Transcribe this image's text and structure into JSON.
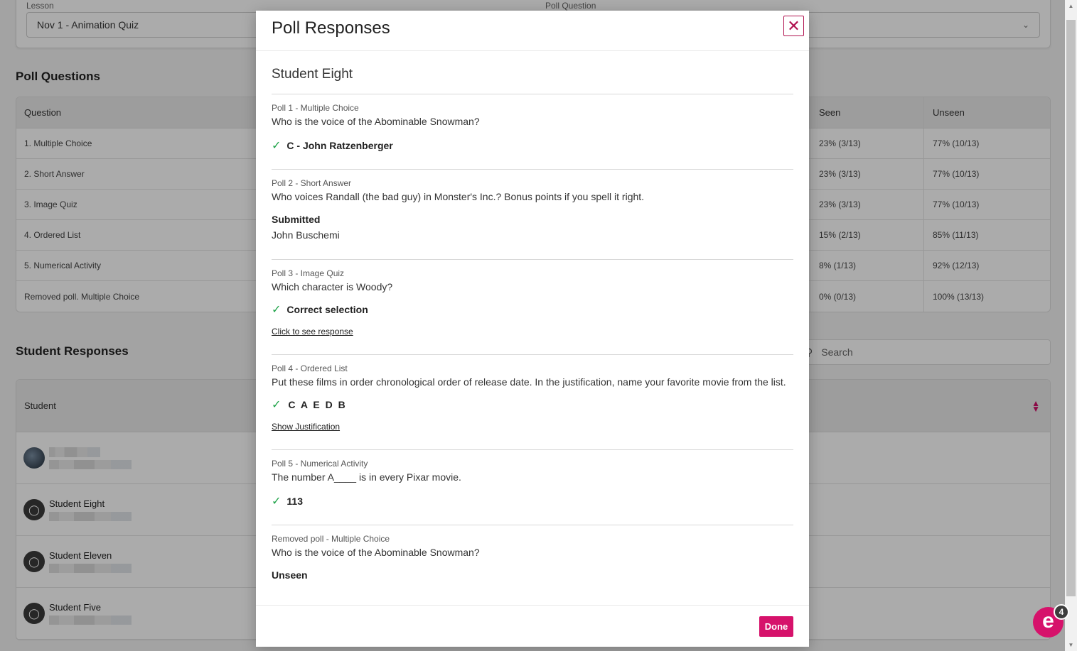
{
  "filters": {
    "lesson_label": "Lesson",
    "lesson_value": "Nov 1 - Animation Quiz",
    "question_label": "Poll Question"
  },
  "poll_questions": {
    "title": "Poll Questions",
    "headers": {
      "question": "Question",
      "seen": "Seen",
      "unseen": "Unseen"
    },
    "rows": [
      {
        "question": "1. Multiple Choice",
        "seen": "23% (3/13)",
        "unseen": "77% (10/13)"
      },
      {
        "question": "2. Short Answer",
        "seen": "23% (3/13)",
        "unseen": "77% (10/13)"
      },
      {
        "question": "3. Image Quiz",
        "seen": "23% (3/13)",
        "unseen": "77% (10/13)"
      },
      {
        "question": "4. Ordered List",
        "seen": "15% (2/13)",
        "unseen": "85% (11/13)"
      },
      {
        "question": "5. Numerical Activity",
        "seen": "8% (1/13)",
        "unseen": "92% (12/13)"
      },
      {
        "question": "Removed poll. Multiple Choice",
        "seen": "0% (0/13)",
        "unseen": "100% (13/13)"
      }
    ]
  },
  "student_responses": {
    "title": "Student Responses",
    "search_placeholder": "Search",
    "header_student": "Student",
    "rows": [
      {
        "name": ""
      },
      {
        "name": "Student Eight"
      },
      {
        "name": "Student Eleven"
      },
      {
        "name": "Student Five"
      }
    ]
  },
  "modal": {
    "title": "Poll Responses",
    "close_symbol": "✕",
    "student_name": "Student Eight",
    "polls": [
      {
        "label": "Poll 1 - Multiple Choice",
        "question": "Who is the voice of the Abominable Snowman?",
        "answer": "C - John Ratzenberger"
      },
      {
        "label": "Poll 2 - Short Answer",
        "question": "Who voices Randall (the bad guy) in Monster's Inc.? Bonus points if you spell it right.",
        "status": "Submitted",
        "answer": "John Buschemi"
      },
      {
        "label": "Poll 3 - Image Quiz",
        "question": "Which character is Woody?",
        "answer": "Correct selection",
        "link": "Click to see response"
      },
      {
        "label": "Poll 4 - Ordered List",
        "question": "Put these films in order chronological order of release date. In the justification, name your favorite movie from the list.",
        "answer": "C A E D B",
        "link": "Show Justification"
      },
      {
        "label": "Poll 5 - Numerical Activity",
        "question": "The number A____ is in every Pixar movie.",
        "answer": "113"
      },
      {
        "label": "Removed poll - Multiple Choice",
        "question": "Who is the voice of the Abominable Snowman?",
        "status": "Unseen"
      }
    ],
    "done_label": "Done"
  },
  "chat": {
    "logo_letter": "e",
    "badge_count": "4"
  },
  "colors": {
    "accent": "#d6126b",
    "check": "#1fa349",
    "overlay": "rgba(0,0,0,0.33)"
  }
}
